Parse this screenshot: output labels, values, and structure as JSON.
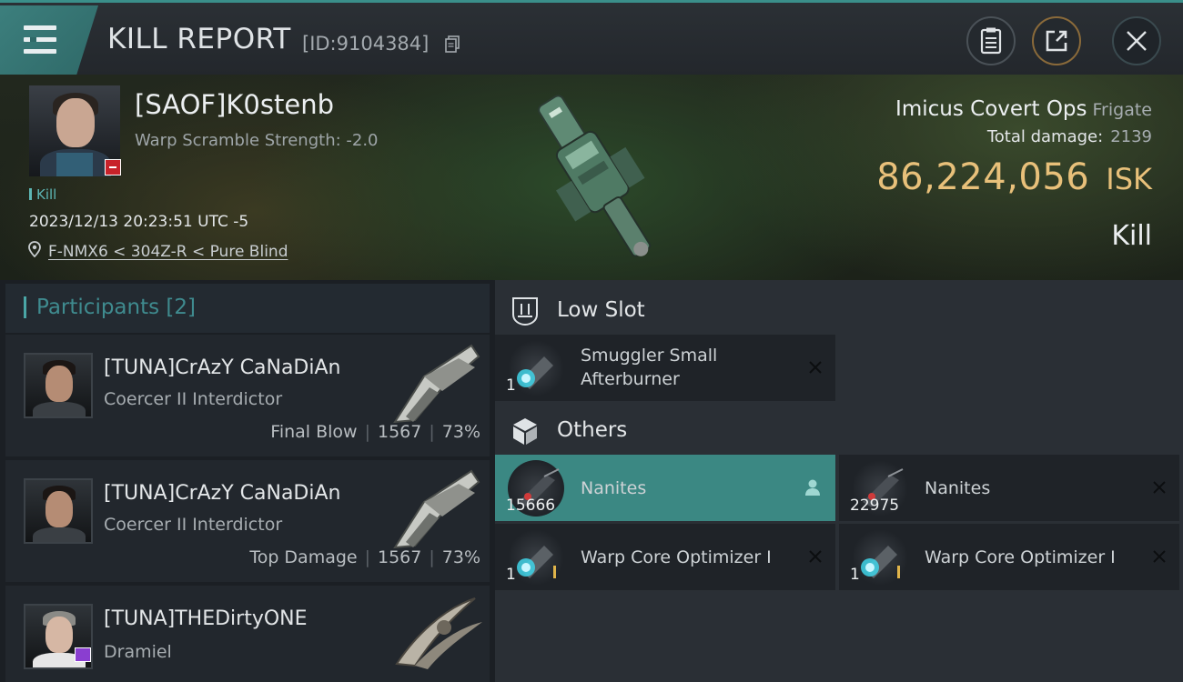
{
  "header": {
    "title": "KILL REPORT",
    "report_id": "[ID:9104384]"
  },
  "victim": {
    "name": "[SAOF]K0stenb",
    "warp_scramble": "Warp Scramble Strength: -2.0",
    "kill_tag": "Kill",
    "time": "2023/12/13 20:23:51 UTC -5",
    "location": "F-NMX6 < 304Z-R < Pure Blind",
    "ship_name": "Imicus Covert Ops",
    "ship_class": "Frigate",
    "total_damage_label": "Total damage:",
    "total_damage": "2139",
    "isk_value": "86,224,056",
    "isk_unit": "ISK",
    "kill_type": "Kill"
  },
  "participants": {
    "title": "Participants [2]",
    "items": [
      {
        "name": "[TUNA]CrAzY CaNaDiAn",
        "ship": "Coercer II Interdictor",
        "role": "Final Blow",
        "damage": "1567",
        "percent": "73%"
      },
      {
        "name": "[TUNA]CrAzY CaNaDiAn",
        "ship": "Coercer II Interdictor",
        "role": "Top Damage",
        "damage": "1567",
        "percent": "73%"
      },
      {
        "name": "[TUNA]THEDirtyONE",
        "ship": "Dramiel"
      }
    ]
  },
  "slots": {
    "low_slot": {
      "title": "Low Slot",
      "items": [
        {
          "qty": "1",
          "name": "Smuggler Small Afterburner",
          "status": "destroyed"
        }
      ]
    },
    "others": {
      "title": "Others",
      "items": [
        {
          "qty": "15666",
          "name": "Nanites",
          "status": "dropped"
        },
        {
          "qty": "22975",
          "name": "Nanites",
          "status": "destroyed"
        },
        {
          "qty": "1",
          "name": "Warp Core Optimizer I",
          "status": "destroyed"
        },
        {
          "qty": "1",
          "name": "Warp Core Optimizer I",
          "status": "destroyed"
        }
      ]
    }
  },
  "colors": {
    "accent": "#3b8883",
    "isk": "#e8c07a",
    "badge_red": "#c8222a"
  },
  "icons": {
    "menu": "hamburger-icon",
    "copy": "copy-icon",
    "clipboard": "clipboard-icon",
    "share": "share-icon",
    "close": "close-icon",
    "location": "location-pin-icon",
    "low_slot": "low-slot-icon",
    "others": "cube-icon",
    "remove": "x-icon",
    "person": "person-icon"
  }
}
